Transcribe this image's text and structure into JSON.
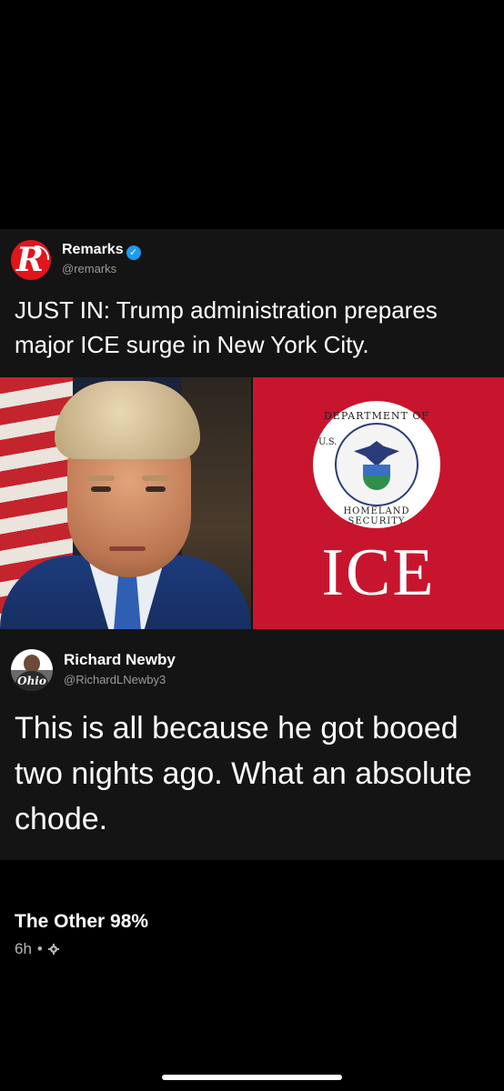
{
  "post": {
    "tweet": {
      "author_name": "Remarks",
      "author_handle": "@remarks",
      "logo_letter": "R",
      "text": "JUST IN: Trump administration prepares major ICE surge in New York City.",
      "media": {
        "left": "portrait-photo",
        "right": {
          "seal_top": "DEPARTMENT OF",
          "seal_left": "U.S.",
          "seal_bottom": "HOMELAND SECURITY",
          "label": "ICE"
        }
      }
    },
    "reply": {
      "author_name": "Richard Newby",
      "author_handle": "@RichardLNewby3",
      "avatar_text": "Ohio",
      "text": "This is all because he got booed two nights ago. What an absolute chode."
    }
  },
  "page": {
    "name": "The Other 98%",
    "time": "6h",
    "separator": "•",
    "privacy_icon": "gear-icon"
  },
  "colors": {
    "background": "#000000",
    "card": "#141414",
    "brand_red": "#e2141c",
    "ice_red": "#c8152e",
    "verified": "#1d9bf0"
  }
}
